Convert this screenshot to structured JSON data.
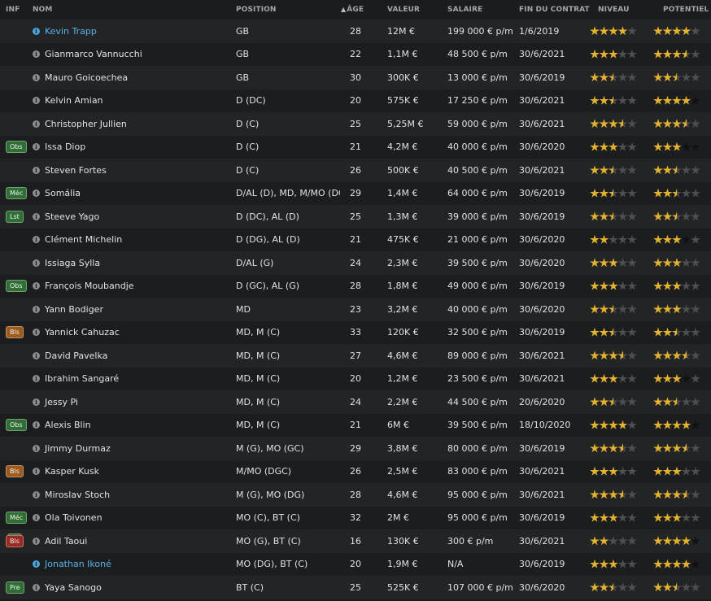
{
  "headers": {
    "inf": "INF",
    "name": "NOM",
    "position": "POSITION",
    "age": "ÂGE",
    "value": "VALEUR",
    "salary": "SALAIRE",
    "contract": "FIN DU CONTRAT",
    "level": "NIVEAU",
    "potential": "POTENTIEL"
  },
  "colors": {
    "star": "#e4b22c",
    "highlight": "#5ab2e8",
    "badge_green": "#2f6e34",
    "badge_orange": "#9c5a1c",
    "badge_red": "#9a2a24"
  },
  "players": [
    {
      "badge": "",
      "badge_color": "",
      "name": "Kevin Trapp",
      "highlight": true,
      "position": "GB",
      "age": "28",
      "value": "12M €",
      "salary": "199 000 € p/m",
      "contract": "1/6/2019",
      "level": 4,
      "potential": 4,
      "potential_dark": 0
    },
    {
      "badge": "",
      "badge_color": "",
      "name": "Gianmarco Vannucchi",
      "highlight": false,
      "position": "GB",
      "age": "22",
      "value": "1,1M €",
      "salary": "48 500 € p/m",
      "contract": "30/6/2021",
      "level": 3,
      "potential": 3.5,
      "potential_dark": 0
    },
    {
      "badge": "",
      "badge_color": "",
      "name": "Mauro Goicoechea",
      "highlight": false,
      "position": "GB",
      "age": "30",
      "value": "300K €",
      "salary": "13 000 € p/m",
      "contract": "30/6/2019",
      "level": 2.5,
      "potential": 2.5,
      "potential_dark": 0
    },
    {
      "badge": "",
      "badge_color": "",
      "name": "Kelvin Amian",
      "highlight": false,
      "position": "D (DC)",
      "age": "20",
      "value": "575K €",
      "salary": "17 250 € p/m",
      "contract": "30/6/2021",
      "level": 2.5,
      "potential": 4,
      "potential_dark": 1
    },
    {
      "badge": "",
      "badge_color": "",
      "name": "Christopher Jullien",
      "highlight": false,
      "position": "D (C)",
      "age": "25",
      "value": "5,25M €",
      "salary": "59 000 € p/m",
      "contract": "30/6/2021",
      "level": 3.5,
      "potential": 3.5,
      "potential_dark": 0
    },
    {
      "badge": "Obs",
      "badge_color": "green",
      "name": "Issa Diop",
      "highlight": false,
      "position": "D (C)",
      "age": "21",
      "value": "4,2M €",
      "salary": "40 000 € p/m",
      "contract": "30/6/2020",
      "level": 3,
      "potential": 3,
      "potential_dark": 2
    },
    {
      "badge": "",
      "badge_color": "",
      "name": "Steven Fortes",
      "highlight": false,
      "position": "D (C)",
      "age": "26",
      "value": "500K €",
      "salary": "40 500 € p/m",
      "contract": "30/6/2021",
      "level": 2.5,
      "potential": 2.5,
      "potential_dark": 0
    },
    {
      "badge": "Méc",
      "badge_color": "green",
      "name": "Somália",
      "highlight": false,
      "position": "D/AL (D), MD, M/MO (DC)",
      "age": "29",
      "value": "1,4M €",
      "salary": "64 000 € p/m",
      "contract": "30/6/2019",
      "level": 2.5,
      "potential": 2.5,
      "potential_dark": 0
    },
    {
      "badge": "Lst",
      "badge_color": "green",
      "name": "Steeve Yago",
      "highlight": false,
      "position": "D (DC), AL (D)",
      "age": "25",
      "value": "1,3M €",
      "salary": "39 000 € p/m",
      "contract": "30/6/2019",
      "level": 2.5,
      "potential": 2.5,
      "potential_dark": 0
    },
    {
      "badge": "",
      "badge_color": "",
      "name": "Clément Michelin",
      "highlight": false,
      "position": "D (DG), AL (D)",
      "age": "21",
      "value": "475K €",
      "salary": "21 000 € p/m",
      "contract": "30/6/2020",
      "level": 2,
      "potential": 3,
      "potential_dark": 0.5
    },
    {
      "badge": "",
      "badge_color": "",
      "name": "Issiaga Sylla",
      "highlight": false,
      "position": "D/AL (G)",
      "age": "24",
      "value": "2,3M €",
      "salary": "39 500 € p/m",
      "contract": "30/6/2020",
      "level": 3,
      "potential": 3,
      "potential_dark": 0
    },
    {
      "badge": "Obs",
      "badge_color": "green",
      "name": "François Moubandje",
      "highlight": false,
      "position": "D (GC), AL (G)",
      "age": "28",
      "value": "1,8M €",
      "salary": "49 000 € p/m",
      "contract": "30/6/2019",
      "level": 3,
      "potential": 3,
      "potential_dark": 0
    },
    {
      "badge": "",
      "badge_color": "",
      "name": "Yann Bodiger",
      "highlight": false,
      "position": "MD",
      "age": "23",
      "value": "3,2M €",
      "salary": "40 000 € p/m",
      "contract": "30/6/2020",
      "level": 2.5,
      "potential": 3,
      "potential_dark": 0
    },
    {
      "badge": "Bls",
      "badge_color": "orange",
      "name": "Yannick Cahuzac",
      "highlight": false,
      "position": "MD, M (C)",
      "age": "33",
      "value": "120K €",
      "salary": "32 500 € p/m",
      "contract": "30/6/2019",
      "level": 2.5,
      "potential": 2.5,
      "potential_dark": 0
    },
    {
      "badge": "",
      "badge_color": "",
      "name": "David Pavelka",
      "highlight": false,
      "position": "MD, M (C)",
      "age": "27",
      "value": "4,6M €",
      "salary": "89 000 € p/m",
      "contract": "30/6/2021",
      "level": 3.5,
      "potential": 3.5,
      "potential_dark": 0
    },
    {
      "badge": "",
      "badge_color": "",
      "name": "Ibrahim Sangaré",
      "highlight": false,
      "position": "MD, M (C)",
      "age": "20",
      "value": "1,2M €",
      "salary": "23 500 € p/m",
      "contract": "30/6/2021",
      "level": 3,
      "potential": 3,
      "potential_dark": 1
    },
    {
      "badge": "",
      "badge_color": "",
      "name": "Jessy Pi",
      "highlight": false,
      "position": "MD, M (C)",
      "age": "24",
      "value": "2,2M €",
      "salary": "44 500 € p/m",
      "contract": "20/6/2020",
      "level": 2.5,
      "potential": 2.5,
      "potential_dark": 0
    },
    {
      "badge": "Obs",
      "badge_color": "green",
      "name": "Alexis Blin",
      "highlight": false,
      "position": "MD, M (C)",
      "age": "21",
      "value": "6M €",
      "salary": "39 500 € p/m",
      "contract": "18/10/2020",
      "level": 4,
      "potential": 4,
      "potential_dark": 1
    },
    {
      "badge": "",
      "badge_color": "",
      "name": "Jimmy Durmaz",
      "highlight": false,
      "position": "M (G), MO (GC)",
      "age": "29",
      "value": "3,8M €",
      "salary": "80 000 € p/m",
      "contract": "30/6/2019",
      "level": 3.5,
      "potential": 3.5,
      "potential_dark": 0
    },
    {
      "badge": "Bls",
      "badge_color": "orange",
      "name": "Kasper Kusk",
      "highlight": false,
      "position": "M/MO (DGC)",
      "age": "26",
      "value": "2,5M €",
      "salary": "83 000 € p/m",
      "contract": "30/6/2021",
      "level": 3,
      "potential": 3,
      "potential_dark": 0
    },
    {
      "badge": "",
      "badge_color": "",
      "name": "Miroslav Stoch",
      "highlight": false,
      "position": "M (G), MO (DG)",
      "age": "28",
      "value": "4,6M €",
      "salary": "95 000 € p/m",
      "contract": "30/6/2021",
      "level": 3.5,
      "potential": 3.5,
      "potential_dark": 0
    },
    {
      "badge": "Méc",
      "badge_color": "green",
      "name": "Ola Toivonen",
      "highlight": false,
      "position": "MO (C), BT (C)",
      "age": "32",
      "value": "2M €",
      "salary": "95 000 € p/m",
      "contract": "30/6/2019",
      "level": 3,
      "potential": 3,
      "potential_dark": 0
    },
    {
      "badge": "Bls",
      "badge_color": "red",
      "stack": true,
      "name": "Adil Taoui",
      "highlight": false,
      "position": "MO (G), BT (C)",
      "age": "16",
      "value": "130K €",
      "salary": "300 € p/m",
      "contract": "30/6/2021",
      "level": 2,
      "potential": 4,
      "potential_dark": 1
    },
    {
      "badge": "",
      "badge_color": "",
      "name": "Jonathan Ikoné",
      "highlight": true,
      "position": "MO (DG), BT (C)",
      "age": "20",
      "value": "1,9M €",
      "salary": "N/A",
      "contract": "30/6/2019",
      "level": 3,
      "potential": 4,
      "potential_dark": 1
    },
    {
      "badge": "Pre",
      "badge_color": "green",
      "name": "Yaya Sanogo",
      "highlight": false,
      "position": "BT (C)",
      "age": "25",
      "value": "525K €",
      "salary": "107 000 € p/m",
      "contract": "30/6/2020",
      "level": 2.5,
      "potential": 2.5,
      "potential_dark": 0
    }
  ]
}
